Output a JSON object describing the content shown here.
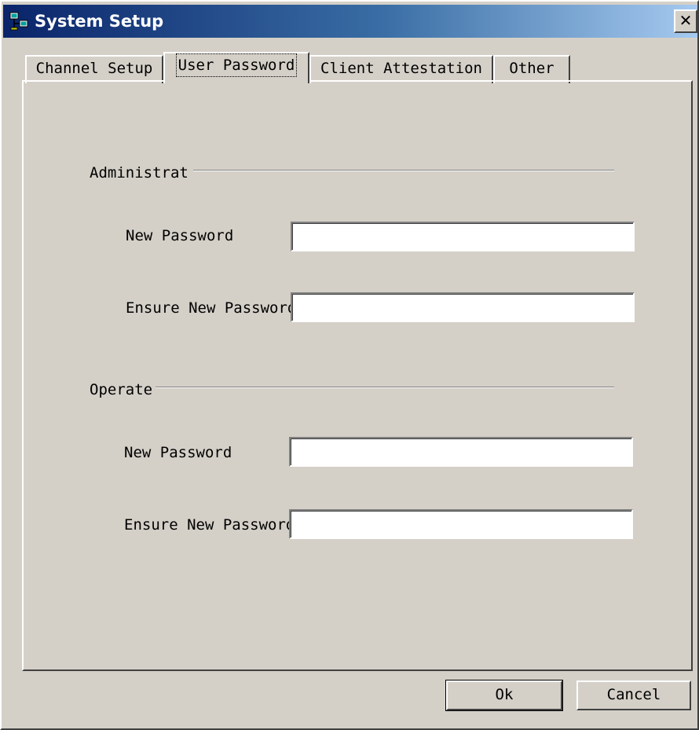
{
  "window": {
    "title": "System Setup",
    "close_label": "✕"
  },
  "tabs": [
    {
      "label": "Channel Setup",
      "active": false
    },
    {
      "label": "User Password",
      "active": true
    },
    {
      "label": "Client Attestation",
      "active": false
    },
    {
      "label": "Other",
      "active": false
    }
  ],
  "admin_group": {
    "title": "Administrat",
    "new_password_label": "New Password",
    "new_password_value": "",
    "ensure_password_label": "Ensure New Password",
    "ensure_password_value": ""
  },
  "operate_group": {
    "title": "Operate",
    "new_password_label": "New Password",
    "new_password_value": "",
    "ensure_password_label": "Ensure New Password",
    "ensure_password_value": ""
  },
  "buttons": {
    "ok_label": "Ok",
    "cancel_label": "Cancel"
  },
  "icons": {
    "app": "network-computer-icon",
    "close": "close-icon"
  }
}
